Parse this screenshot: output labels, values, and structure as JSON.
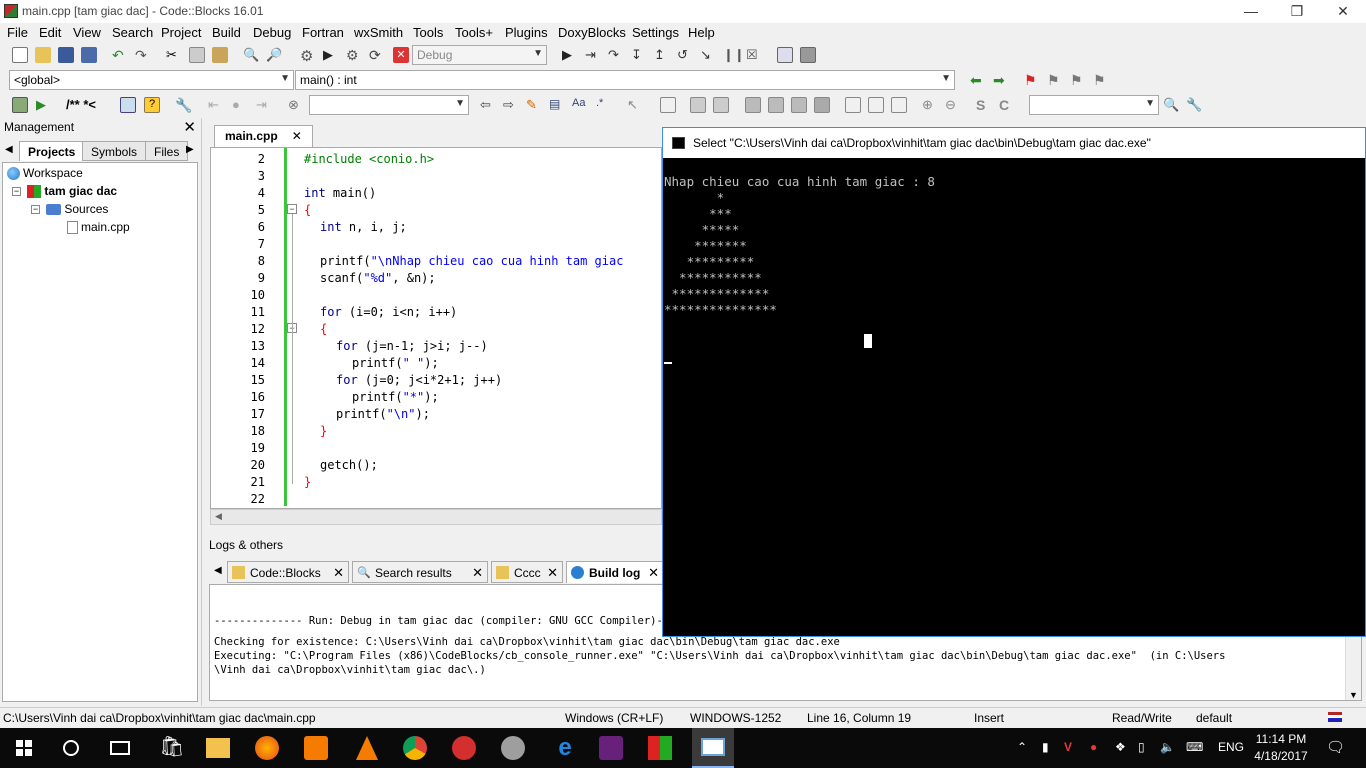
{
  "window": {
    "title": "main.cpp [tam giac dac] - Code::Blocks 16.01"
  },
  "menu": [
    "File",
    "Edit",
    "View",
    "Search",
    "Project",
    "Build",
    "Debug",
    "Fortran",
    "wxSmith",
    "Tools",
    "Tools+",
    "Plugins",
    "DoxyBlocks",
    "Settings",
    "Help"
  ],
  "toolbar": {
    "build_target": "Debug",
    "scope": "<global>",
    "function": "main() : int",
    "doxy_label": "/** *<"
  },
  "management": {
    "title": "Management",
    "tabs": [
      "Projects",
      "Symbols",
      "Files"
    ],
    "tree": {
      "workspace": "Workspace",
      "project": "tam giac dac",
      "folder": "Sources",
      "file": "main.cpp"
    }
  },
  "editor": {
    "tab_label": "main.cpp",
    "lines": [
      {
        "n": "2"
      },
      {
        "n": "3"
      },
      {
        "n": "4"
      },
      {
        "n": "5"
      },
      {
        "n": "6"
      },
      {
        "n": "7"
      },
      {
        "n": "8"
      },
      {
        "n": "9"
      },
      {
        "n": "10"
      },
      {
        "n": "11"
      },
      {
        "n": "12"
      },
      {
        "n": "13"
      },
      {
        "n": "14"
      },
      {
        "n": "15"
      },
      {
        "n": "16"
      },
      {
        "n": "17"
      },
      {
        "n": "18"
      },
      {
        "n": "19"
      },
      {
        "n": "20"
      },
      {
        "n": "21"
      },
      {
        "n": "22"
      }
    ],
    "code": {
      "l2": "#include <conio.h>",
      "l4a": "int",
      "l4b": " main()",
      "l5": "{",
      "l6a": "int",
      "l6b": " n, i, j;",
      "l8a": "printf(",
      "l8b": "\"\\nNhap chieu cao cua hinh tam giac",
      "l9a": "scanf(",
      "l9b": "\"%d\"",
      "l9c": ", &n);",
      "l11a": "for",
      "l11b": " (i=0; i<n; i++)",
      "l12": "{",
      "l13a": "for",
      "l13b": " (j=n-1; j>i; j--)",
      "l14a": "printf(",
      "l14b": "\" \"",
      "l14c": ");",
      "l15a": "for",
      "l15b": " (j=0; j<i*2+1; j++)",
      "l16a": "printf(",
      "l16b": "\"*\"",
      "l16c": ");",
      "l17a": "printf(",
      "l17b": "\"\\n\"",
      "l17c": ");",
      "l18": "}",
      "l20": "getch();",
      "l21": "}"
    }
  },
  "logs": {
    "title": "Logs & others",
    "tabs": [
      "Code::Blocks",
      "Search results",
      "Cccc",
      "Build log"
    ],
    "lines": [
      "-------------- Run: Debug in tam giac dac (compiler: GNU GCC Compiler)---------------",
      "Checking for existence: C:\\Users\\Vinh dai ca\\Dropbox\\vinhit\\tam giac dac\\bin\\Debug\\tam giac dac.exe",
      "Executing: \"C:\\Program Files (x86)\\CodeBlocks/cb_console_runner.exe\" \"C:\\Users\\Vinh dai ca\\Dropbox\\vinhit\\tam giac dac\\bin\\Debug\\tam giac dac.exe\"  (in C:\\Users",
      "\\Vinh dai ca\\Dropbox\\vinhit\\tam giac dac\\.)"
    ]
  },
  "console": {
    "title": "Select \"C:\\Users\\Vinh dai ca\\Dropbox\\vinhit\\tam giac dac\\bin\\Debug\\tam giac dac.exe\"",
    "lines": [
      "Nhap chieu cao cua hinh tam giac : 8",
      "       *",
      "      ***",
      "     *****",
      "    *******",
      "   *********",
      "  ***********",
      " *************",
      "***************"
    ]
  },
  "status": {
    "path": "C:\\Users\\Vinh dai ca\\Dropbox\\vinhit\\tam giac dac\\main.cpp",
    "eol": "Windows (CR+LF)",
    "encoding": "WINDOWS-1252",
    "position": "Line 16, Column 19",
    "mode": "Insert",
    "access": "Read/Write",
    "lang": "default"
  },
  "taskbar": {
    "language": "ENG",
    "time": "11:14 PM",
    "date": "4/18/2017"
  }
}
